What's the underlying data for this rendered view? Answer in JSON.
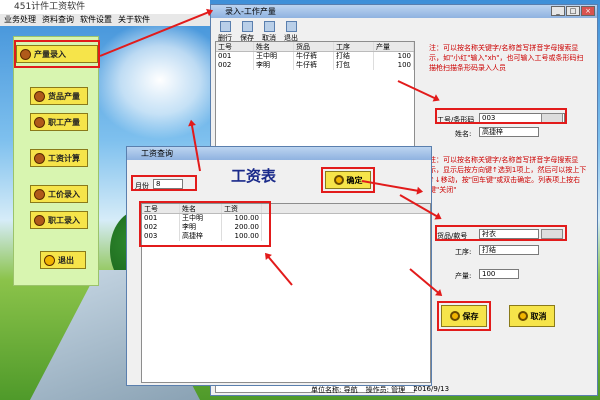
{
  "app": {
    "title": "451计件工资软件"
  },
  "menu": [
    "业务处理",
    "资料查询",
    "软件设置",
    "关于软件"
  ],
  "sidebar": {
    "items": [
      {
        "label": "产量录入"
      },
      {
        "label": "货品产量"
      },
      {
        "label": "职工产量"
      },
      {
        "label": "工资计算"
      },
      {
        "label": "工价录入"
      },
      {
        "label": "职工录入"
      },
      {
        "label": "退出"
      }
    ]
  },
  "entry_window": {
    "title": "录入-工作产量",
    "toolbar": [
      "删行",
      "保存",
      "取消",
      "退出"
    ],
    "grid": {
      "columns": [
        "工号",
        "姓名",
        "货品",
        "工序",
        "产量"
      ],
      "rows": [
        [
          "001",
          "王中明",
          "牛仔裤",
          "打结",
          "100"
        ],
        [
          "002",
          "李明",
          "牛仔裤",
          "打包",
          "100"
        ]
      ]
    },
    "note1": "注：可以按名称关键字/名称首写拼音字母搜索显示，如\"小红\"输入\"xh\"，也可输入工号或条形码扫描枪扫描条形码录入人员",
    "note2": "注：可以按名称关键字/名称首写拼音字母搜索显示，显示后按方向键↑选到1项上，然后可以按上下↑↓移动，按\"回车键\"或双击确定。列表项上按右键\"关闭\"",
    "fields": {
      "worker_id_label": "工号/条形码",
      "worker_id_value": "003",
      "name_label": "姓名:",
      "name_value": "高捷梓",
      "product_label": "货品/款号",
      "product_value": "衬衣",
      "process_label": "工序:",
      "process_value": "打结",
      "qty_label": "产量:",
      "qty_value": "100"
    },
    "save_label": "保存",
    "cancel_label": "取消"
  },
  "salary_window": {
    "title": "工资查询",
    "heading": "工资表",
    "month_label": "月份",
    "month_value": "8",
    "confirm_label": "确定",
    "grid": {
      "columns": [
        "工号",
        "姓名",
        "工资"
      ],
      "rows": [
        [
          "001",
          "王中明",
          "100.00"
        ],
        [
          "002",
          "李明",
          "200.00"
        ],
        [
          "003",
          "高捷梓",
          "100.00"
        ]
      ]
    }
  },
  "status_bar": {
    "company": "单位名称: 导航",
    "operator": "操作员: 管理",
    "date": "2016/9/13"
  },
  "colors": {
    "accent_red": "#e21b1b",
    "button_yellow": "#f6e44a",
    "panel_green": "#d8f5b0"
  }
}
